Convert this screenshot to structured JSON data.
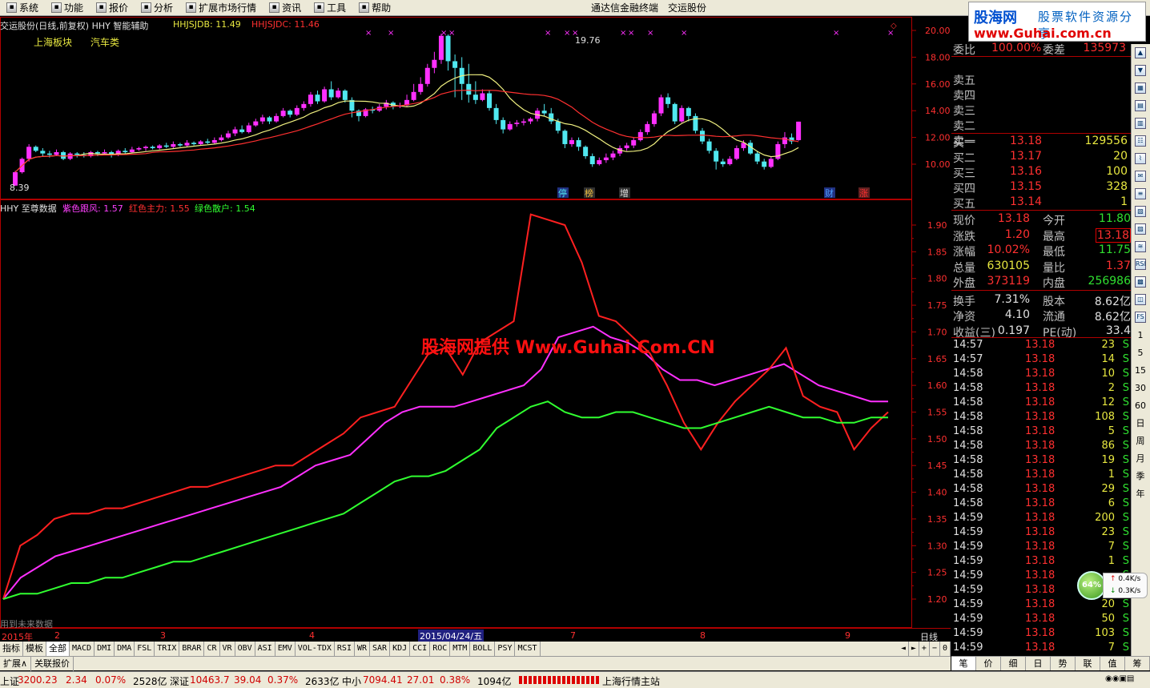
{
  "menu": {
    "items": [
      {
        "icon": "system-icon",
        "label": "系统"
      },
      {
        "icon": "function-icon",
        "label": "功能"
      },
      {
        "icon": "quote-icon",
        "label": "报价"
      },
      {
        "icon": "analysis-icon",
        "label": "分析"
      },
      {
        "icon": "ext-market-icon",
        "label": "扩展市场行情"
      },
      {
        "icon": "news-icon",
        "label": "资讯"
      },
      {
        "icon": "tools-icon",
        "label": "工具"
      },
      {
        "icon": "help-icon",
        "label": "帮助"
      }
    ],
    "app_title": "通达信金融终端",
    "stock_title": "交运股份"
  },
  "brand": {
    "name": "股海网",
    "slogan": "股票软件资源分享",
    "url": "www.Guhai.com.cn"
  },
  "main_chart": {
    "header": "交运股份(日线,前复权) HHY 智能辅助",
    "hhsjdb_label": "HHJSJDB: 11.49",
    "hhsjdc_label": "HHJSJDC: 11.46",
    "sector": "上海板块",
    "industry": "汽车类",
    "high_label": "19.76",
    "low_label": "8.39",
    "price_ticks": [
      "20.00",
      "18.00",
      "16.00",
      "14.00",
      "12.00",
      "10.00"
    ],
    "event_markers": [
      "停",
      "榜",
      "增",
      "财",
      "涨"
    ]
  },
  "sub_chart": {
    "header": "HHY 至尊数据",
    "purple_label": "紫色跟风: 1.57",
    "red_label": "红色主力: 1.55",
    "green_label": "绿色散户: 1.54",
    "y_ticks": [
      "1.90",
      "1.85",
      "1.80",
      "1.75",
      "1.70",
      "1.65",
      "1.60",
      "1.55",
      "1.50",
      "1.45",
      "1.40",
      "1.35",
      "1.30",
      "1.25",
      "1.20"
    ],
    "footnote": "用到未来数据",
    "watermark": "股海网提供 Www.Guhai.Com.CN",
    "colors": {
      "purple": "#ff30ff",
      "red": "#ff2020",
      "green": "#30ff30"
    }
  },
  "chart_data": {
    "type": "line",
    "title": "HHY 至尊数据",
    "y_range": [
      1.18,
      1.94
    ],
    "series": [
      {
        "name": "紫色跟风",
        "color": "#ff30ff",
        "values": [
          1.2,
          1.24,
          1.26,
          1.28,
          1.29,
          1.3,
          1.31,
          1.32,
          1.33,
          1.34,
          1.35,
          1.36,
          1.37,
          1.38,
          1.39,
          1.4,
          1.41,
          1.43,
          1.45,
          1.46,
          1.47,
          1.5,
          1.53,
          1.55,
          1.56,
          1.56,
          1.56,
          1.57,
          1.58,
          1.59,
          1.6,
          1.63,
          1.69,
          1.7,
          1.71,
          1.69,
          1.68,
          1.66,
          1.63,
          1.61,
          1.61,
          1.6,
          1.61,
          1.62,
          1.63,
          1.64,
          1.62,
          1.6,
          1.59,
          1.58,
          1.57,
          1.57
        ]
      },
      {
        "name": "红色主力",
        "color": "#ff2020",
        "values": [
          1.2,
          1.3,
          1.32,
          1.35,
          1.36,
          1.36,
          1.37,
          1.37,
          1.38,
          1.39,
          1.4,
          1.41,
          1.41,
          1.42,
          1.43,
          1.44,
          1.45,
          1.45,
          1.47,
          1.49,
          1.51,
          1.54,
          1.55,
          1.56,
          1.61,
          1.66,
          1.67,
          1.62,
          1.68,
          1.7,
          1.72,
          1.92,
          1.91,
          1.9,
          1.83,
          1.73,
          1.72,
          1.69,
          1.66,
          1.6,
          1.53,
          1.48,
          1.53,
          1.57,
          1.6,
          1.63,
          1.67,
          1.58,
          1.56,
          1.55,
          1.48,
          1.52,
          1.55
        ]
      },
      {
        "name": "绿色散户",
        "color": "#30ff30",
        "values": [
          1.2,
          1.21,
          1.21,
          1.22,
          1.23,
          1.23,
          1.24,
          1.24,
          1.25,
          1.26,
          1.27,
          1.27,
          1.28,
          1.29,
          1.3,
          1.31,
          1.32,
          1.33,
          1.34,
          1.35,
          1.36,
          1.38,
          1.4,
          1.42,
          1.43,
          1.43,
          1.44,
          1.46,
          1.48,
          1.52,
          1.54,
          1.56,
          1.57,
          1.55,
          1.54,
          1.54,
          1.55,
          1.55,
          1.54,
          1.53,
          1.52,
          1.52,
          1.53,
          1.54,
          1.55,
          1.56,
          1.55,
          1.54,
          1.54,
          1.53,
          1.53,
          1.54,
          1.54
        ]
      }
    ]
  },
  "candles": {
    "y_range": [
      8.0,
      20.6
    ],
    "ma_colors": {
      "ma1": "#f0f080",
      "ma2": "#ff3030"
    },
    "bars": [
      [
        8.4,
        9.4,
        8.39,
        9.5
      ],
      [
        9.4,
        10.4,
        9.3,
        10.5
      ],
      [
        10.4,
        11.3,
        10.2,
        11.5
      ],
      [
        11.3,
        11.0,
        10.9,
        11.4
      ],
      [
        11.0,
        10.8,
        10.6,
        11.2
      ],
      [
        10.8,
        10.7,
        10.5,
        11.0
      ],
      [
        10.7,
        10.9,
        10.6,
        11.1
      ],
      [
        10.9,
        10.4,
        10.3,
        11.0
      ],
      [
        10.4,
        10.8,
        10.3,
        10.9
      ],
      [
        10.8,
        10.7,
        10.5,
        10.9
      ],
      [
        10.7,
        10.6,
        10.5,
        10.9
      ],
      [
        10.6,
        10.9,
        10.5,
        11.0
      ],
      [
        10.9,
        10.8,
        10.6,
        11.0
      ],
      [
        10.8,
        10.9,
        10.7,
        11.1
      ],
      [
        10.9,
        10.7,
        10.5,
        11.0
      ],
      [
        10.7,
        11.0,
        10.6,
        11.1
      ],
      [
        11.0,
        10.9,
        10.8,
        11.2
      ],
      [
        10.9,
        11.1,
        10.8,
        11.3
      ],
      [
        11.1,
        11.2,
        11.0,
        11.3
      ],
      [
        11.2,
        11.3,
        11.0,
        11.4
      ],
      [
        11.3,
        11.2,
        11.1,
        11.4
      ],
      [
        11.2,
        11.4,
        11.1,
        11.5
      ],
      [
        11.4,
        11.3,
        11.2,
        11.6
      ],
      [
        11.3,
        11.5,
        11.2,
        11.7
      ],
      [
        11.5,
        11.4,
        11.3,
        11.6
      ],
      [
        11.4,
        11.6,
        11.3,
        11.8
      ],
      [
        11.6,
        11.5,
        11.4,
        11.7
      ],
      [
        11.5,
        11.7,
        11.4,
        11.8
      ],
      [
        11.7,
        11.6,
        11.5,
        11.9
      ],
      [
        11.6,
        11.8,
        11.5,
        12.0
      ],
      [
        11.8,
        12.0,
        11.7,
        12.2
      ],
      [
        12.0,
        12.3,
        11.9,
        12.5
      ],
      [
        12.3,
        12.6,
        12.1,
        12.8
      ],
      [
        12.6,
        12.4,
        12.3,
        12.9
      ],
      [
        12.4,
        12.9,
        12.3,
        13.1
      ],
      [
        12.9,
        13.2,
        12.8,
        13.4
      ],
      [
        13.2,
        13.5,
        13.0,
        13.7
      ],
      [
        13.5,
        13.2,
        13.0,
        13.6
      ],
      [
        13.2,
        13.6,
        13.1,
        13.8
      ],
      [
        13.6,
        14.0,
        13.5,
        14.2
      ],
      [
        14.0,
        13.7,
        13.5,
        14.1
      ],
      [
        13.7,
        14.2,
        13.6,
        14.4
      ],
      [
        14.2,
        14.5,
        14.0,
        14.7
      ],
      [
        14.5,
        15.2,
        14.3,
        15.4
      ],
      [
        15.2,
        14.7,
        14.5,
        15.5
      ],
      [
        14.7,
        15.6,
        14.6,
        15.8
      ],
      [
        15.6,
        15.0,
        14.8,
        16.2
      ],
      [
        15.0,
        15.5,
        14.9,
        15.7
      ],
      [
        15.5,
        14.8,
        14.6,
        15.6
      ],
      [
        14.8,
        14.0,
        13.5,
        15.0
      ],
      [
        14.0,
        13.6,
        13.2,
        14.1
      ],
      [
        13.6,
        14.1,
        13.5,
        14.2
      ],
      [
        14.1,
        14.0,
        13.8,
        14.3
      ],
      [
        14.0,
        14.3,
        13.9,
        14.5
      ],
      [
        14.3,
        14.6,
        14.1,
        14.8
      ],
      [
        14.6,
        14.3,
        14.1,
        14.7
      ],
      [
        14.3,
        14.4,
        14.2,
        14.6
      ],
      [
        14.4,
        14.8,
        14.3,
        15.2
      ],
      [
        14.8,
        15.4,
        14.7,
        16.0
      ],
      [
        15.4,
        16.0,
        15.2,
        16.5
      ],
      [
        16.0,
        17.2,
        15.8,
        17.5
      ],
      [
        17.2,
        17.8,
        16.8,
        18.4
      ],
      [
        17.8,
        19.6,
        17.5,
        19.76
      ],
      [
        19.6,
        17.7,
        17.0,
        19.7
      ],
      [
        17.7,
        17.2,
        15.0,
        18.2
      ],
      [
        17.2,
        16.0,
        14.8,
        18.0
      ],
      [
        16.0,
        15.2,
        14.6,
        17.5
      ],
      [
        15.2,
        14.8,
        14.5,
        16.2
      ],
      [
        14.8,
        15.3,
        14.7,
        15.6
      ],
      [
        15.3,
        14.2,
        14.0,
        15.5
      ],
      [
        14.2,
        13.3,
        13.0,
        14.5
      ],
      [
        13.3,
        12.6,
        12.3,
        13.5
      ],
      [
        12.6,
        13.0,
        12.5,
        13.2
      ],
      [
        13.0,
        13.1,
        12.8,
        13.3
      ],
      [
        13.1,
        13.2,
        12.9,
        13.4
      ],
      [
        13.2,
        13.4,
        13.0,
        13.5
      ],
      [
        13.4,
        14.0,
        13.2,
        14.2
      ],
      [
        14.0,
        13.8,
        13.6,
        14.5
      ],
      [
        13.8,
        13.2,
        13.0,
        14.2
      ],
      [
        13.2,
        12.5,
        12.3,
        13.4
      ],
      [
        12.5,
        11.5,
        11.2,
        12.6
      ],
      [
        11.5,
        11.8,
        11.3,
        12.0
      ],
      [
        11.8,
        11.3,
        11.0,
        12.0
      ],
      [
        11.3,
        10.6,
        10.4,
        11.4
      ],
      [
        10.6,
        10.0,
        9.8,
        10.8
      ],
      [
        10.0,
        10.3,
        9.9,
        10.5
      ],
      [
        10.3,
        10.5,
        10.1,
        10.8
      ],
      [
        10.5,
        10.8,
        10.3,
        11.0
      ],
      [
        10.8,
        11.2,
        10.6,
        11.4
      ],
      [
        11.2,
        11.4,
        11.0,
        11.6
      ],
      [
        11.4,
        11.8,
        11.2,
        12.0
      ],
      [
        11.8,
        12.4,
        11.7,
        12.6
      ],
      [
        12.4,
        13.0,
        12.2,
        13.2
      ],
      [
        13.0,
        13.8,
        12.8,
        14.0
      ],
      [
        13.8,
        15.0,
        13.6,
        15.2
      ],
      [
        15.0,
        14.5,
        14.2,
        15.3
      ],
      [
        14.5,
        13.2,
        13.0,
        14.6
      ],
      [
        13.2,
        14.2,
        13.1,
        14.4
      ],
      [
        14.2,
        13.6,
        13.2,
        14.3
      ],
      [
        13.6,
        12.5,
        12.3,
        13.8
      ],
      [
        12.5,
        11.7,
        11.5,
        12.7
      ],
      [
        11.7,
        11.0,
        10.8,
        11.9
      ],
      [
        11.0,
        10.2,
        9.6,
        11.2
      ],
      [
        10.2,
        10.0,
        9.8,
        10.4
      ],
      [
        10.0,
        10.4,
        9.9,
        10.6
      ],
      [
        10.4,
        11.2,
        10.3,
        11.4
      ],
      [
        11.2,
        11.6,
        11.0,
        11.8
      ],
      [
        11.6,
        10.8,
        10.7,
        11.8
      ],
      [
        10.8,
        10.2,
        10.0,
        11.0
      ],
      [
        10.2,
        9.8,
        9.6,
        10.4
      ],
      [
        9.8,
        10.4,
        9.7,
        10.6
      ],
      [
        10.4,
        11.5,
        10.3,
        11.7
      ],
      [
        11.5,
        12.0,
        11.2,
        12.4
      ],
      [
        12.0,
        11.7,
        11.5,
        12.3
      ],
      [
        11.8,
        13.18,
        11.75,
        13.18
      ]
    ]
  },
  "date_strip": {
    "year": "2015年",
    "months": [
      "2",
      "3",
      "4",
      "5",
      "7",
      "8",
      "9"
    ],
    "cursor_date": "2015/04/24/五",
    "period": "日线"
  },
  "indicator_tabs": [
    "指标",
    "模板",
    "全部",
    "MACD",
    "DMI",
    "DMA",
    "FSL",
    "TRIX",
    "BRAR",
    "CR",
    "VR",
    "OBV",
    "ASI",
    "EMV",
    "VOL-TDX",
    "RSI",
    "WR",
    "SAR",
    "KDJ",
    "CCI",
    "ROC",
    "MTM",
    "BOLL",
    "PSY",
    "MCST"
  ],
  "sub_tabs": [
    "扩展∧",
    "关联报价"
  ],
  "scroll_controls": [
    "◄",
    "►",
    "+",
    "−",
    "0"
  ],
  "orderbook": {
    "weibi_label": "委比",
    "weibi_value": "100.00%",
    "weicha_label": "委差",
    "weicha_value": "135973",
    "sells": [
      {
        "label": "卖五"
      },
      {
        "label": "卖四"
      },
      {
        "label": "卖三"
      },
      {
        "label": "卖二"
      },
      {
        "label": "卖一"
      }
    ],
    "buys": [
      {
        "label": "买一",
        "price": "13.18",
        "vol": "129556"
      },
      {
        "label": "买二",
        "price": "13.17",
        "vol": "20"
      },
      {
        "label": "买三",
        "price": "13.16",
        "vol": "100"
      },
      {
        "label": "买四",
        "price": "13.15",
        "vol": "328"
      },
      {
        "label": "买五",
        "price": "13.14",
        "vol": "1"
      }
    ]
  },
  "stats": [
    {
      "l1": "现价",
      "v1": "13.18",
      "c1": "red",
      "l2": "今开",
      "v2": "11.80",
      "c2": "green"
    },
    {
      "l1": "涨跌",
      "v1": "1.20",
      "c1": "red",
      "l2": "最高",
      "v2": "13.18",
      "c2": "red"
    },
    {
      "l1": "涨幅",
      "v1": "10.02%",
      "c1": "red",
      "l2": "最低",
      "v2": "11.75",
      "c2": "green"
    },
    {
      "l1": "总量",
      "v1": "630105",
      "c1": "yellow",
      "l2": "量比",
      "v2": "1.37",
      "c2": "red"
    },
    {
      "l1": "外盘",
      "v1": "373119",
      "c1": "red",
      "l2": "内盘",
      "v2": "256986",
      "c2": "green"
    },
    {
      "l1": "换手",
      "v1": "7.31%",
      "c1": "white",
      "l2": "股本",
      "v2": "8.62亿",
      "c2": "white"
    },
    {
      "l1": "净资",
      "v1": "4.10",
      "c1": "white",
      "l2": "流通",
      "v2": "8.62亿",
      "c2": "white"
    },
    {
      "l1": "收益(三)",
      "v1": "0.197",
      "c1": "white",
      "l2": "PE(动)",
      "v2": "33.4",
      "c2": "white"
    }
  ],
  "ticks": [
    {
      "t": "14:57",
      "p": "13.18",
      "v": "23",
      "s": "S"
    },
    {
      "t": "14:57",
      "p": "13.18",
      "v": "14",
      "s": "S"
    },
    {
      "t": "14:58",
      "p": "13.18",
      "v": "10",
      "s": "S"
    },
    {
      "t": "14:58",
      "p": "13.18",
      "v": "2",
      "s": "S"
    },
    {
      "t": "14:58",
      "p": "13.18",
      "v": "12",
      "s": "S"
    },
    {
      "t": "14:58",
      "p": "13.18",
      "v": "108",
      "s": "S"
    },
    {
      "t": "14:58",
      "p": "13.18",
      "v": "5",
      "s": "S"
    },
    {
      "t": "14:58",
      "p": "13.18",
      "v": "86",
      "s": "S"
    },
    {
      "t": "14:58",
      "p": "13.18",
      "v": "19",
      "s": "S"
    },
    {
      "t": "14:58",
      "p": "13.18",
      "v": "1",
      "s": "S"
    },
    {
      "t": "14:58",
      "p": "13.18",
      "v": "29",
      "s": "S"
    },
    {
      "t": "14:58",
      "p": "13.18",
      "v": "6",
      "s": "S"
    },
    {
      "t": "14:59",
      "p": "13.18",
      "v": "200",
      "s": "S"
    },
    {
      "t": "14:59",
      "p": "13.18",
      "v": "23",
      "s": "S"
    },
    {
      "t": "14:59",
      "p": "13.18",
      "v": "7",
      "s": "S"
    },
    {
      "t": "14:59",
      "p": "13.18",
      "v": "1",
      "s": "S"
    },
    {
      "t": "14:59",
      "p": "13.18",
      "v": "",
      "s": "S"
    },
    {
      "t": "14:59",
      "p": "13.18",
      "v": "",
      "s": "S"
    },
    {
      "t": "14:59",
      "p": "13.18",
      "v": "20",
      "s": "S"
    },
    {
      "t": "14:59",
      "p": "13.18",
      "v": "50",
      "s": "S"
    },
    {
      "t": "14:59",
      "p": "13.18",
      "v": "103",
      "s": "S"
    },
    {
      "t": "14:59",
      "p": "13.18",
      "v": "7",
      "s": "S"
    }
  ],
  "right_tools": [
    "▲",
    "▼",
    "▦",
    "▤",
    "▥",
    "☷",
    "⌇",
    "✉",
    "≡",
    "▧",
    "▨",
    "≋",
    "RSI",
    "▩",
    "◫",
    "FS",
    "1",
    "5",
    "15",
    "30",
    "60",
    "日",
    "周",
    "月",
    "季",
    "年"
  ],
  "rp_tabs": [
    "笔",
    "价",
    "细",
    "日",
    "势",
    "联",
    "值",
    "筹"
  ],
  "net_widget": {
    "percent": "64%",
    "up": "0.4K/s",
    "down": "0.3K/s"
  },
  "status": {
    "sh_label": "上证",
    "sh_value": "3200.23",
    "sh_change": "2.34",
    "sh_pct": "0.07%",
    "sh_amount": "2528亿",
    "sz_label": "深证",
    "sz_value": "10463.7",
    "sz_change": "39.04",
    "sz_pct": "0.37%",
    "sz_amount": "2633亿",
    "zx_label": "中小",
    "zx_value": "7094.41",
    "zx_change": "27.01",
    "zx_pct": "0.38%",
    "zx_amount": "1094亿",
    "server": "上海行情主站"
  }
}
